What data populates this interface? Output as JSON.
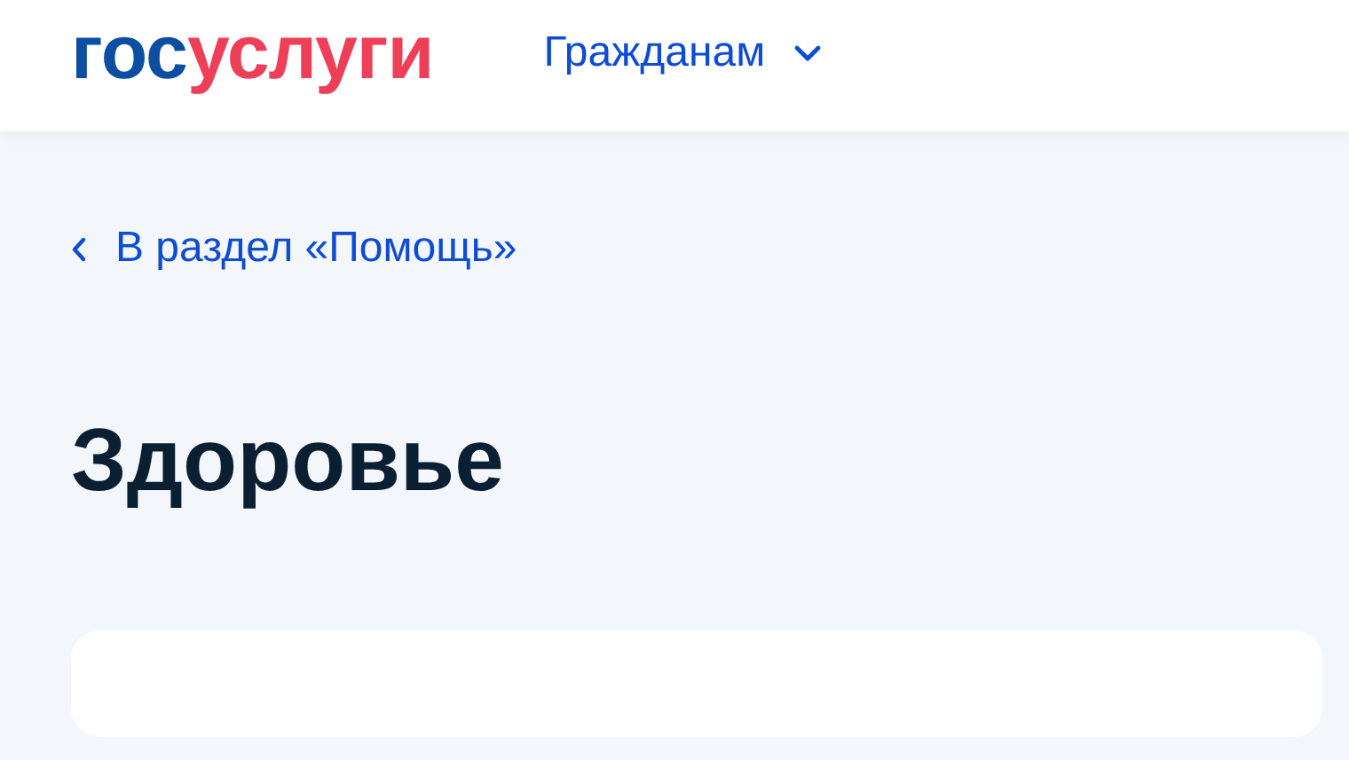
{
  "header": {
    "logo": {
      "first": "гос",
      "second": "услуги"
    },
    "nav": {
      "label": "Гражданам",
      "expanded": false
    }
  },
  "back_link": "В раздел «Помощь»",
  "title": "Здоровье",
  "card": {
    "kind": "empty"
  }
}
